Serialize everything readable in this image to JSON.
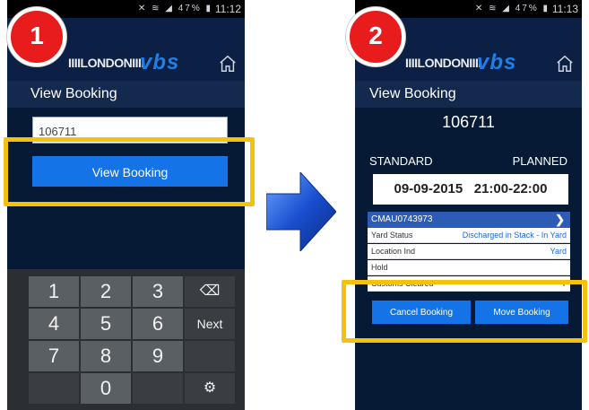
{
  "badges": [
    "1",
    "2"
  ],
  "phone1": {
    "status": {
      "time": "11:12",
      "battery": "47%"
    },
    "logo_london": "IIIILONDONIIII",
    "logo_vbs": "vbs",
    "title": "View Booking",
    "input_value": "106711",
    "view_button_label": "View Booking",
    "keypad": [
      [
        "1",
        "2",
        "3",
        "⌫"
      ],
      [
        "4",
        "5",
        "6",
        "Next"
      ],
      [
        "7",
        "8",
        "9",
        ""
      ],
      [
        "",
        "0",
        "",
        "⚙"
      ]
    ]
  },
  "phone2": {
    "status": {
      "time": "11:13",
      "battery": "47%"
    },
    "logo_london": "IIIILONDONIIII",
    "logo_vbs": "vbs",
    "title": "View Booking",
    "booking_number": "106711",
    "type": "STANDARD",
    "state": "PLANNED",
    "date": "09-09-2015",
    "time_window": "21:00-22:00",
    "container": "CMAU0743973",
    "details": [
      {
        "label": "Yard Status",
        "value": "Discharged in Stack - In Yard"
      },
      {
        "label": "Location Ind",
        "value": "Yard"
      },
      {
        "label": "Hold",
        "value": ""
      },
      {
        "label": "Customs Cleared",
        "value": "Y"
      }
    ],
    "cancel_button_label": "Cancel Booking",
    "move_button_label": "Move Booking"
  },
  "colors": {
    "highlight": "#f4c20d",
    "badge": "#e81c1c",
    "button": "#1473e6",
    "background": "#061a35"
  }
}
